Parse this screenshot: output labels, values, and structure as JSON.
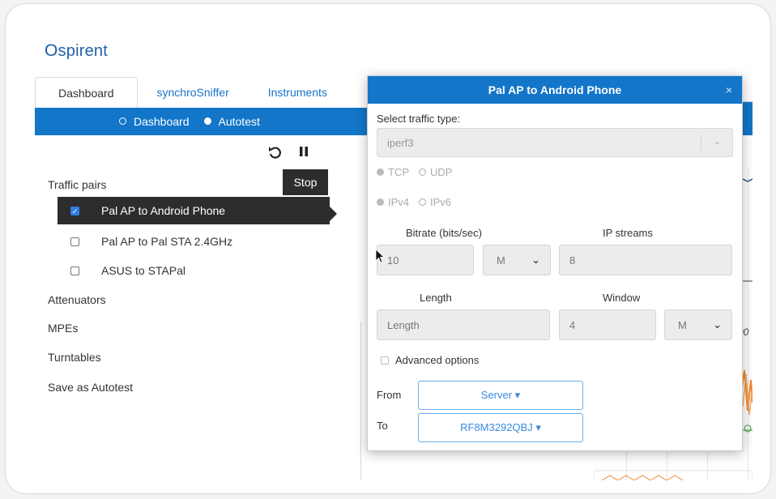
{
  "app": {
    "logo_text": "spirent"
  },
  "tabs": [
    {
      "label": "Dashboard",
      "active": true
    },
    {
      "label": "synchroSniffer",
      "active": false
    },
    {
      "label": "Instruments",
      "active": false
    }
  ],
  "subnav": {
    "dashboard_label": "Dashboard",
    "autotest_label": "Autotest",
    "selected": "Autotest"
  },
  "controls": {
    "stop_label": "Stop",
    "restart_icon": "refresh-icon",
    "pause_icon": "pause-icon"
  },
  "sidebar": {
    "traffic_pairs_label": "Traffic pairs",
    "pairs": [
      {
        "label": "Pal AP to Android Phone",
        "checked": true
      },
      {
        "label": "Pal AP to Pal STA 2.4GHz",
        "checked": false
      },
      {
        "label": "ASUS to STAPal",
        "checked": false
      }
    ],
    "attenuators_label": "Attenuators",
    "mpes_label": "MPEs",
    "turntables_label": "Turntables",
    "save_autotest_label": "Save as Autotest"
  },
  "dialog": {
    "title": "Pal AP to Android Phone",
    "close": "×",
    "traffic_type_label": "Select traffic type:",
    "traffic_type_value": "iperf3",
    "protocols": {
      "tcp": "TCP",
      "udp": "UDP",
      "selected": "TCP"
    },
    "ip_versions": {
      "ipv4": "IPv4",
      "ipv6": "IPv6",
      "selected": "IPv4"
    },
    "bitrate_label": "Bitrate (bits/sec)",
    "bitrate_value": "10",
    "bitrate_unit": "M",
    "ip_streams_label": "IP streams",
    "ip_streams_value": "8",
    "length_label": "Length",
    "length_placeholder": "Length",
    "window_label": "Window",
    "window_value": "4",
    "window_unit": "M",
    "advanced_label": "Advanced options",
    "from_label": "From",
    "from_value": "Server ▾",
    "to_label": "To",
    "to_value": "RF8M3292QBJ ▾"
  },
  "background": {
    "axis_label_fragment": "00"
  },
  "colors": {
    "brand_blue": "#1376c8",
    "dark": "#2d2d2d",
    "series_orange": "#f28a30",
    "series_green": "#3a9a3a"
  }
}
